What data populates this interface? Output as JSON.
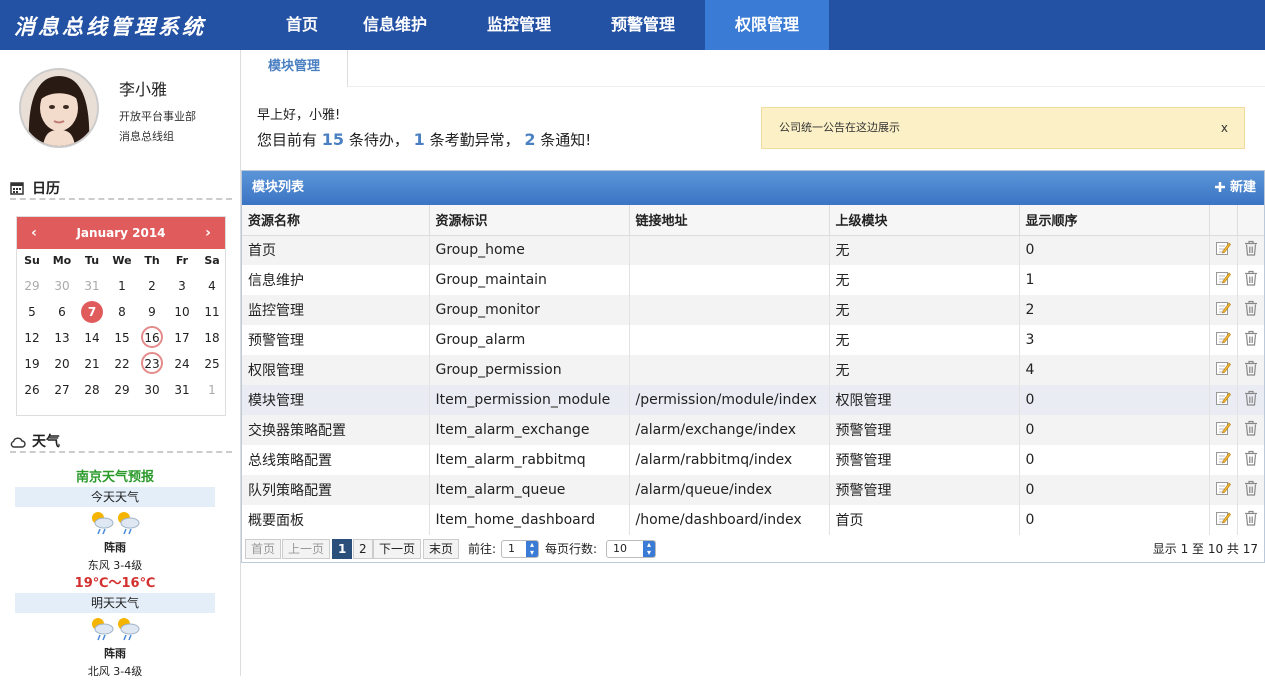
{
  "brand": "消息总线管理系统",
  "nav": [
    {
      "label": "首页",
      "active": false
    },
    {
      "label": "信息维护",
      "active": false
    },
    {
      "label": "监控管理",
      "active": false
    },
    {
      "label": "预警管理",
      "active": false
    },
    {
      "label": "权限管理",
      "active": true
    }
  ],
  "user": {
    "name": "李小雅",
    "dept": "开放平台事业部",
    "group": "消息总线组"
  },
  "calendar": {
    "heading": "日历",
    "month": "January 2014",
    "prev": "‹",
    "next": "›",
    "weekdays": [
      "Su",
      "Mo",
      "Tu",
      "We",
      "Th",
      "Fr",
      "Sa"
    ],
    "days": [
      {
        "d": "29",
        "muted": true
      },
      {
        "d": "30",
        "muted": true
      },
      {
        "d": "31",
        "muted": true
      },
      {
        "d": "1"
      },
      {
        "d": "2"
      },
      {
        "d": "3"
      },
      {
        "d": "4"
      },
      {
        "d": "5"
      },
      {
        "d": "6"
      },
      {
        "d": "7",
        "today": true
      },
      {
        "d": "8"
      },
      {
        "d": "9"
      },
      {
        "d": "10"
      },
      {
        "d": "11"
      },
      {
        "d": "12"
      },
      {
        "d": "13"
      },
      {
        "d": "14"
      },
      {
        "d": "15"
      },
      {
        "d": "16",
        "ring": true
      },
      {
        "d": "17"
      },
      {
        "d": "18"
      },
      {
        "d": "19"
      },
      {
        "d": "20"
      },
      {
        "d": "21"
      },
      {
        "d": "22"
      },
      {
        "d": "23",
        "ring": true
      },
      {
        "d": "24"
      },
      {
        "d": "25"
      },
      {
        "d": "26"
      },
      {
        "d": "27"
      },
      {
        "d": "28"
      },
      {
        "d": "29"
      },
      {
        "d": "30"
      },
      {
        "d": "31"
      },
      {
        "d": "1",
        "muted": true
      }
    ]
  },
  "weather": {
    "heading": "天气",
    "title": "南京天气预报",
    "today_label": "今天天气",
    "today_desc": "阵雨",
    "today_wind": "东风 3-4级",
    "today_temp": "19℃～16℃",
    "tomorrow_label": "明天天气",
    "tomorrow_desc": "阵雨",
    "tomorrow_wind": "北风 3-4级"
  },
  "tab": {
    "label": "模块管理"
  },
  "greeting": {
    "line1": "早上好，小雅!",
    "prefix": "您目前有",
    "todo_count": "15",
    "todo_label": "条待办，",
    "attendance_count": "1",
    "attendance_label": "条考勤异常，",
    "notice_count": "2",
    "notice_label": "条通知!"
  },
  "notice": {
    "text": "公司统一公告在这边展示",
    "close": "x"
  },
  "panel": {
    "title": "模块列表",
    "new_label": "新建"
  },
  "table": {
    "columns": [
      "资源名称",
      "资源标识",
      "链接地址",
      "上级模块",
      "显示顺序"
    ],
    "rows": [
      {
        "name": "首页",
        "id": "Group_home",
        "url": "",
        "parent": "无",
        "order": "0"
      },
      {
        "name": "信息维护",
        "id": "Group_maintain",
        "url": "",
        "parent": "无",
        "order": "1"
      },
      {
        "name": "监控管理",
        "id": "Group_monitor",
        "url": "",
        "parent": "无",
        "order": "2"
      },
      {
        "name": "预警管理",
        "id": "Group_alarm",
        "url": "",
        "parent": "无",
        "order": "3"
      },
      {
        "name": "权限管理",
        "id": "Group_permission",
        "url": "",
        "parent": "无",
        "order": "4"
      },
      {
        "name": "模块管理",
        "id": "Item_permission_module",
        "url": "/permission/module/index",
        "parent": "权限管理",
        "order": "0"
      },
      {
        "name": "交换器策略配置",
        "id": "Item_alarm_exchange",
        "url": "/alarm/exchange/index",
        "parent": "预警管理",
        "order": "0"
      },
      {
        "name": "总线策略配置",
        "id": "Item_alarm_rabbitmq",
        "url": "/alarm/rabbitmq/index",
        "parent": "预警管理",
        "order": "0"
      },
      {
        "name": "队列策略配置",
        "id": "Item_alarm_queue",
        "url": "/alarm/queue/index",
        "parent": "预警管理",
        "order": "0"
      },
      {
        "name": "概要面板",
        "id": "Item_home_dashboard",
        "url": "/home/dashboard/index",
        "parent": "首页",
        "order": "0"
      }
    ]
  },
  "pager": {
    "first": "首页",
    "prev": "上一页",
    "page1": "1",
    "page2": "2",
    "next": "下一页",
    "last": "末页",
    "goto_label": "前往:",
    "goto_value": "1",
    "size_label": "每页行数:",
    "size_value": "10",
    "summary": "显示 1 至 10 共 17"
  },
  "colors": {
    "nav_bg": "#2351a3",
    "nav_active": "#3a7bd5",
    "calendar_accent": "#e05c5c",
    "panel_head": "#3b74c3",
    "notice_bg": "#fcf0c7"
  }
}
